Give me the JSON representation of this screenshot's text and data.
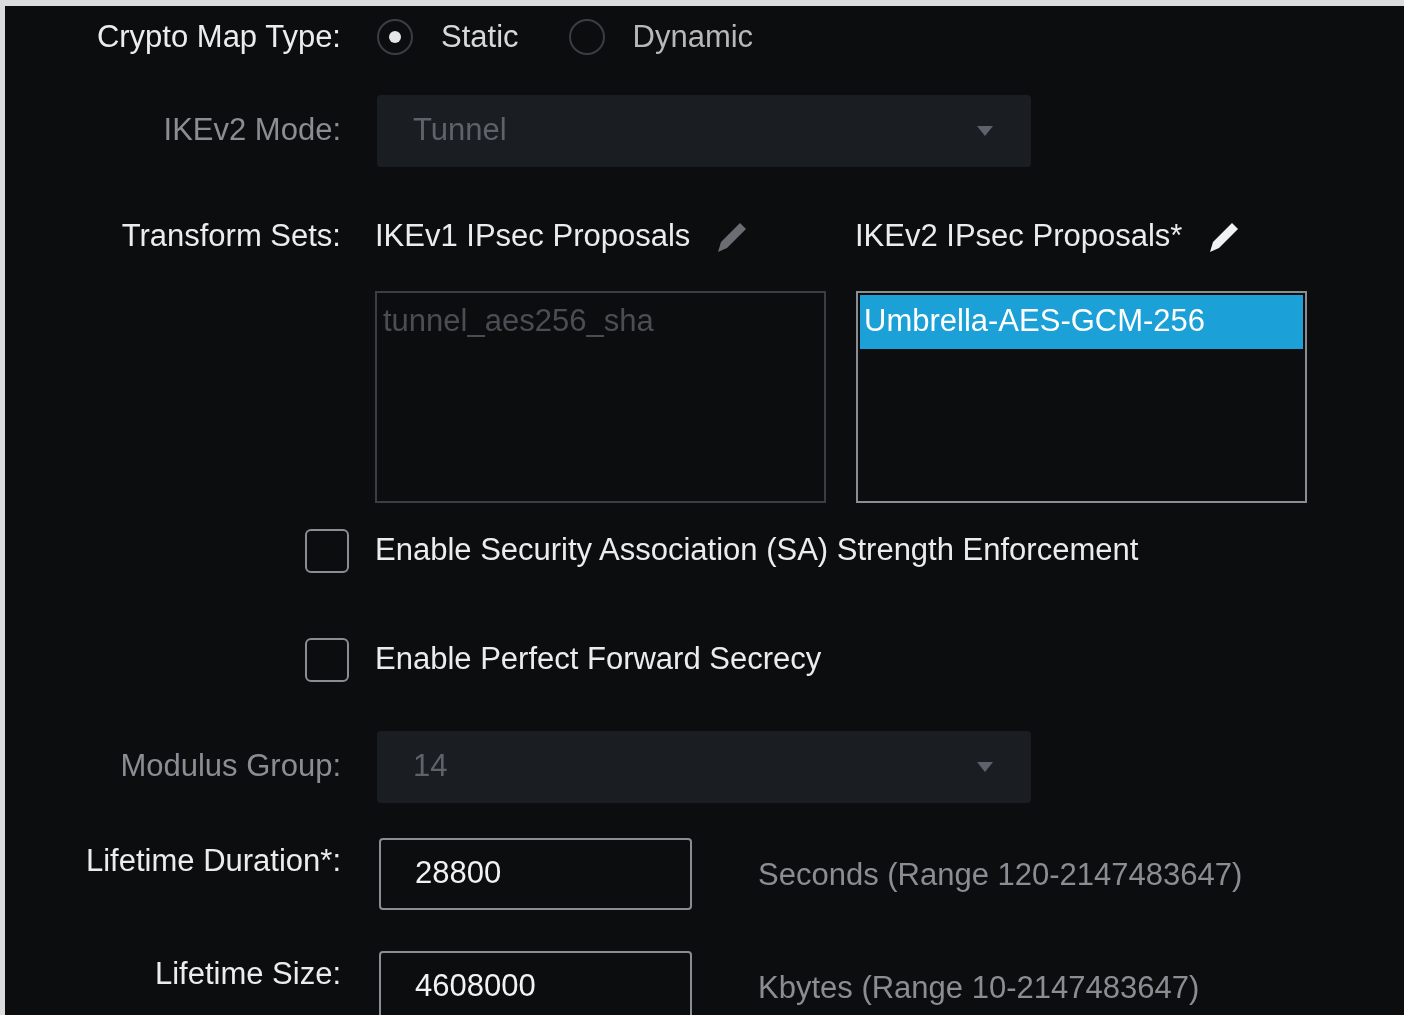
{
  "crypto_map_type": {
    "label": "Crypto Map Type:",
    "options": [
      {
        "label": "Static",
        "selected": true
      },
      {
        "label": "Dynamic",
        "selected": false
      }
    ]
  },
  "ikev2_mode": {
    "label": "IKEv2 Mode:",
    "value": "Tunnel",
    "disabled": true
  },
  "transform_sets": {
    "label": "Transform Sets:",
    "lists": [
      {
        "title": "IKEv1 IPsec Proposals",
        "disabled": true,
        "items": [
          {
            "label": "tunnel_aes256_sha",
            "selected": false
          }
        ]
      },
      {
        "title": "IKEv2 IPsec Proposals*",
        "disabled": false,
        "items": [
          {
            "label": "Umbrella-AES-GCM-256",
            "selected": true
          }
        ]
      }
    ]
  },
  "checkboxes": [
    {
      "label": "Enable Security Association (SA) Strength Enforcement",
      "checked": false
    },
    {
      "label": "Enable Perfect Forward Secrecy",
      "checked": false
    }
  ],
  "modulus_group": {
    "label": "Modulus Group:",
    "value": "14",
    "disabled": true
  },
  "lifetime_duration": {
    "label": "Lifetime Duration*:",
    "value": "28800",
    "hint": "Seconds (Range 120-2147483647)"
  },
  "lifetime_size": {
    "label": "Lifetime Size:",
    "value": "4608000",
    "hint": "Kbytes (Range 10-2147483647)"
  }
}
